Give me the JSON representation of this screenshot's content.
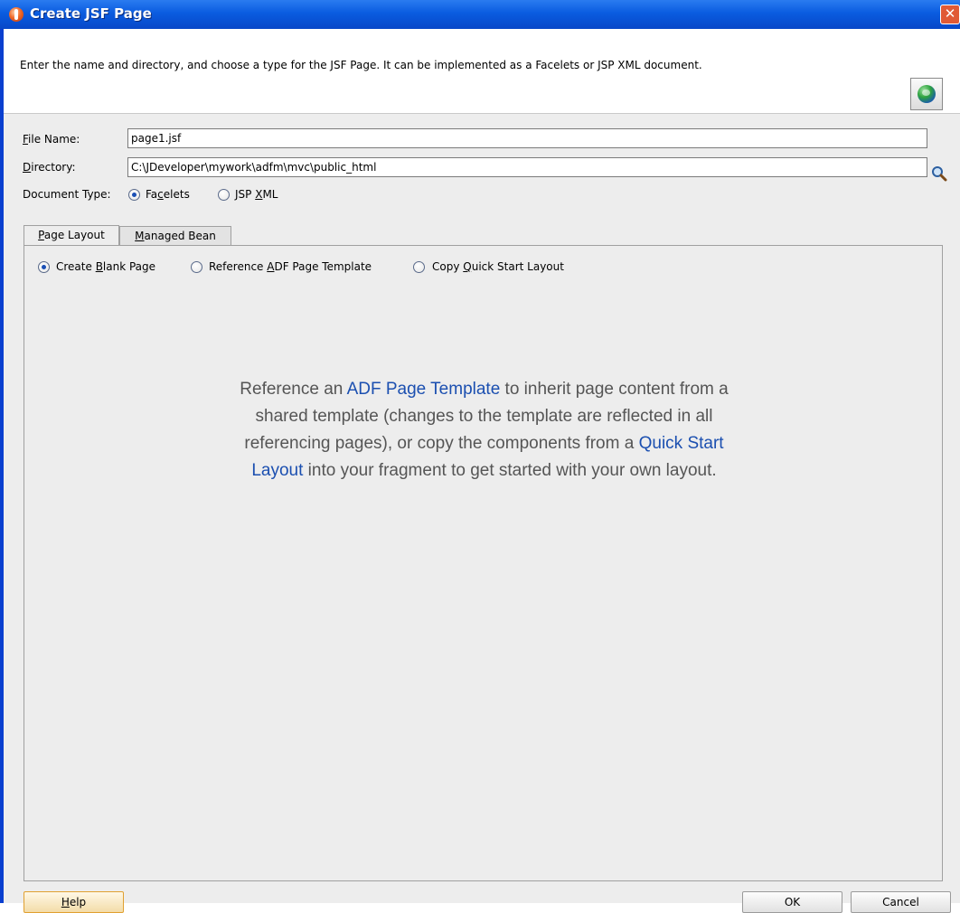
{
  "window": {
    "title": "Create JSF Page",
    "close_glyph": "✕"
  },
  "header": {
    "description": "Enter the name and directory, and choose a type for the JSF Page. It can be implemented as a Facelets or JSP XML document.",
    "icon": "globe-icon"
  },
  "form": {
    "file_name_label_access": "F",
    "file_name_label_rest": "ile Name:",
    "file_name_value": "page1.jsf",
    "directory_label_access": "D",
    "directory_label_rest": "irectory:",
    "directory_value": "C:\\JDeveloper\\mywork\\adfm\\mvc\\public_html",
    "browse_icon": "search-icon",
    "document_type_label": "Document Type:",
    "document_types": [
      {
        "pre": "Fa",
        "access": "c",
        "post": "elets",
        "selected": true
      },
      {
        "pre": "JSP ",
        "access": "X",
        "post": "ML",
        "selected": false
      }
    ]
  },
  "tabs": [
    {
      "access": "P",
      "rest": "age Layout",
      "active": true
    },
    {
      "access": "M",
      "rest": "anaged Bean",
      "active": false
    }
  ],
  "layout_options": [
    {
      "pre": "Create ",
      "access": "B",
      "post": "lank Page",
      "selected": true
    },
    {
      "pre": "Reference ",
      "access": "A",
      "post": "DF Page Template",
      "selected": false
    },
    {
      "pre": "Copy ",
      "access": "Q",
      "post": "uick Start Layout",
      "selected": false
    }
  ],
  "info": {
    "part1": "Reference an ",
    "link1": "ADF Page Template",
    "part2": " to inherit page content from a shared template (changes to the template are reflected in all referencing pages), or copy the components from a ",
    "link2": "Quick Start Layout",
    "part3": " into your fragment to get started with your own layout.",
    "link_color": "#1b4fb0",
    "text_color": "#555555"
  },
  "buttons": {
    "help_access": "H",
    "help_rest": "elp",
    "ok": "OK",
    "cancel": "Cancel"
  }
}
